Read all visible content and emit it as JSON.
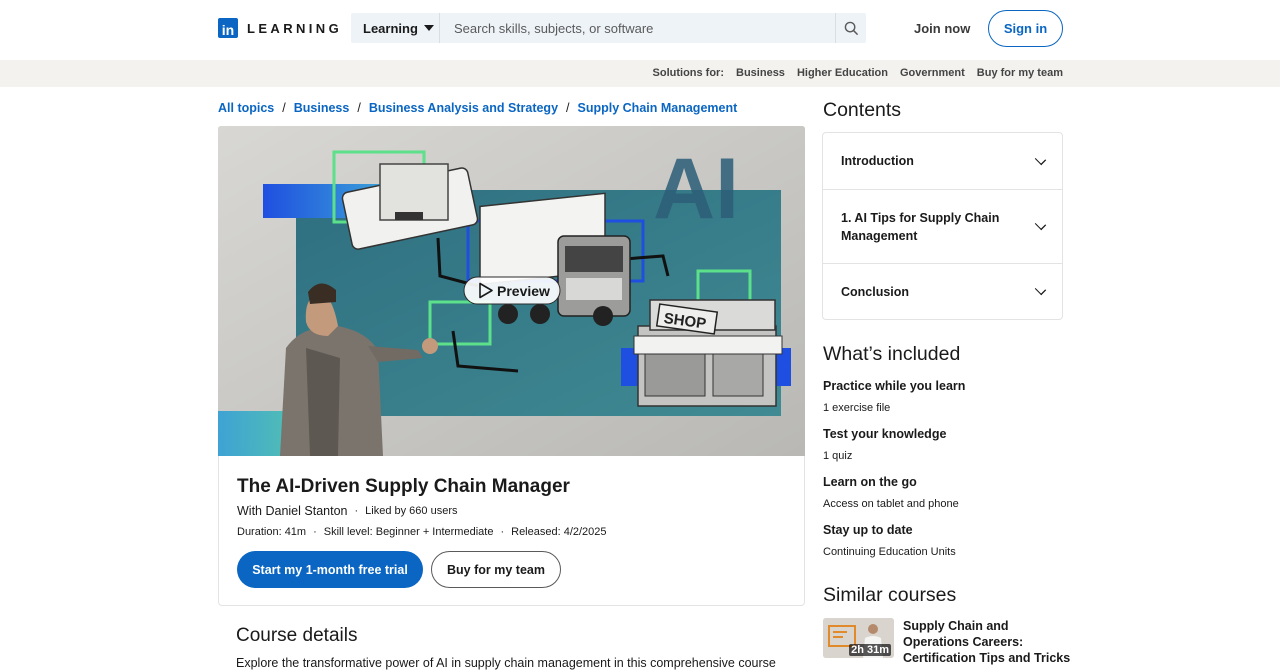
{
  "header": {
    "logo_mark": "in",
    "logo_word": "LEARNING",
    "search_category": "Learning",
    "search_placeholder": "Search skills, subjects, or software",
    "join_label": "Join now",
    "signin_label": "Sign in",
    "brand_color": "#0a66c2"
  },
  "solutions": {
    "label": "Solutions for:",
    "links": [
      "Business",
      "Higher Education",
      "Government",
      "Buy for my team"
    ]
  },
  "breadcrumb": [
    "All topics",
    "Business",
    "Business Analysis and Strategy",
    "Supply Chain Management"
  ],
  "hero": {
    "preview_label": "Preview",
    "shop_sign": "SHOP",
    "backdrop_text": "AI"
  },
  "course": {
    "title": "The AI-Driven Supply Chain Manager",
    "instructor": "With Daniel Stanton",
    "likes": "Liked by 660 users",
    "duration": "Duration: 41m",
    "skill_level": "Skill level: Beginner + Intermediate",
    "released": "Released: 4/2/2025",
    "trial_button": "Start my 1-month free trial",
    "team_button": "Buy for my team"
  },
  "details": {
    "heading": "Course details",
    "text": "Explore the transformative power of AI in supply chain management in this comprehensive course"
  },
  "contents": {
    "heading": "Contents",
    "chapters": [
      "Introduction",
      "1. AI Tips for Supply Chain Management",
      "Conclusion"
    ]
  },
  "included": {
    "heading": "What’s included",
    "items": [
      {
        "title": "Practice while you learn",
        "desc": "1 exercise file"
      },
      {
        "title": "Test your knowledge",
        "desc": "1 quiz"
      },
      {
        "title": "Learn on the go",
        "desc": "Access on tablet and phone"
      },
      {
        "title": "Stay up to date",
        "desc": "Continuing Education Units"
      }
    ]
  },
  "similar": {
    "heading": "Similar courses",
    "items": [
      {
        "title": "Supply Chain and Operations Careers: Certification Tips and Tricks",
        "duration": "2h 31m"
      }
    ]
  }
}
